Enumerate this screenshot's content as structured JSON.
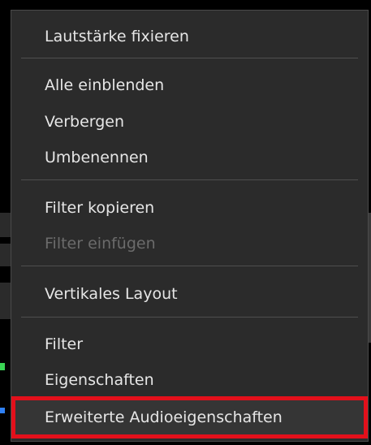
{
  "context_menu": {
    "items": [
      {
        "label": "Lautstärke fixieren",
        "enabled": true
      },
      {
        "label": "Alle einblenden",
        "enabled": true
      },
      {
        "label": "Verbergen",
        "enabled": true
      },
      {
        "label": "Umbenennen",
        "enabled": true
      },
      {
        "label": "Filter kopieren",
        "enabled": true
      },
      {
        "label": "Filter einfügen",
        "enabled": false
      },
      {
        "label": "Vertikales Layout",
        "enabled": true
      },
      {
        "label": "Filter",
        "enabled": true
      },
      {
        "label": "Eigenschaften",
        "enabled": true
      },
      {
        "label": "Erweiterte Audioeigenschaften",
        "enabled": true
      }
    ],
    "highlighted_item": "Erweiterte Audioeigenschaften",
    "highlight_color": "#e3101b"
  }
}
